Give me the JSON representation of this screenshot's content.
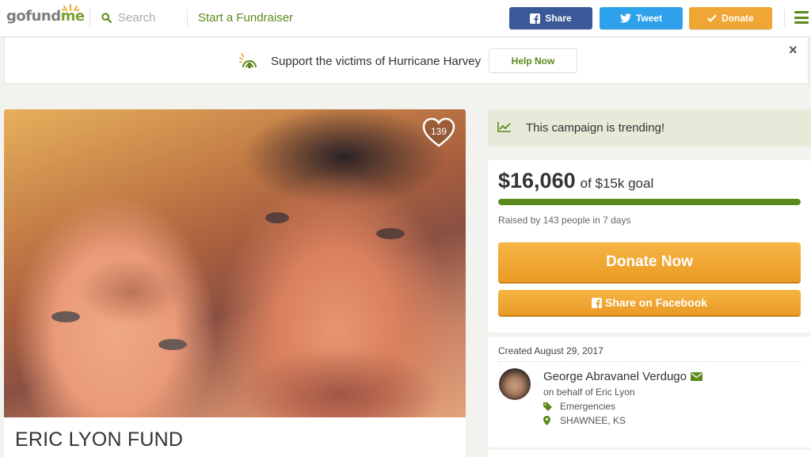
{
  "header": {
    "logo": {
      "part1": "gofund",
      "part2": "me"
    },
    "search_placeholder": "Search",
    "start_fundraiser": "Start a Fundraiser",
    "share_label": "Share",
    "tweet_label": "Tweet",
    "donate_label": "Donate"
  },
  "banner": {
    "text": "Support the victims of Hurricane Harvey",
    "button": "Help Now",
    "close": "×"
  },
  "campaign": {
    "title": "ERIC LYON FUND",
    "hearts": "139"
  },
  "sidebar": {
    "trending": "This campaign is trending!",
    "amount_raised": "$16,060",
    "goal_text": "of $15k goal",
    "progress_fraction": 1.0,
    "raised_by": "Raised by 143 people in 7 days",
    "donate_now": "Donate Now",
    "share_facebook": "Share on Facebook",
    "created": "Created August 29, 2017",
    "organizer_name": "George Abravanel Verdugo",
    "on_behalf": "on behalf of Eric Lyon",
    "category": "Emergencies",
    "location": "SHAWNEE, KS"
  },
  "colors": {
    "brand_green": "#5b8a1c",
    "facebook_blue": "#3b5998",
    "twitter_blue": "#2ea1ec",
    "donate_orange": "#f0a634"
  },
  "icons": [
    "search-icon",
    "facebook-icon",
    "twitter-icon",
    "check-icon",
    "menu-icon",
    "hurricane-icon",
    "close-icon",
    "heart-icon",
    "trending-chart-icon",
    "envelope-icon",
    "tag-icon",
    "location-pin-icon"
  ]
}
